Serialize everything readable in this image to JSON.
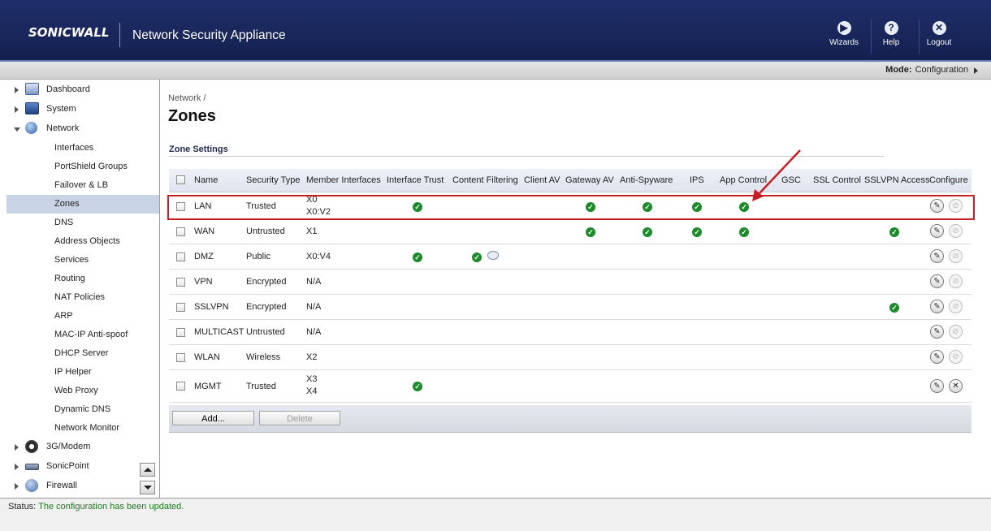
{
  "header": {
    "logo": "SONICWALL",
    "title": "Network Security Appliance",
    "buttons": [
      {
        "label": "Wizards",
        "icon": "wizard-icon",
        "glyph": "▶"
      },
      {
        "label": "Help",
        "icon": "help-icon",
        "glyph": "?"
      },
      {
        "label": "Logout",
        "icon": "logout-icon",
        "glyph": "✕"
      }
    ]
  },
  "mode": {
    "label": "Mode:",
    "value": "Configuration"
  },
  "sidebar": {
    "items": [
      {
        "label": "Dashboard",
        "level": 0,
        "icon": "dashboard-icon",
        "expanded": false
      },
      {
        "label": "System",
        "level": 0,
        "icon": "system-icon",
        "expanded": false
      },
      {
        "label": "Network",
        "level": 0,
        "icon": "network-icon",
        "expanded": true
      },
      {
        "label": "Interfaces",
        "level": 1
      },
      {
        "label": "PortShield Groups",
        "level": 1
      },
      {
        "label": "Failover & LB",
        "level": 1
      },
      {
        "label": "Zones",
        "level": 1,
        "active": true
      },
      {
        "label": "DNS",
        "level": 1
      },
      {
        "label": "Address Objects",
        "level": 1
      },
      {
        "label": "Services",
        "level": 1
      },
      {
        "label": "Routing",
        "level": 1
      },
      {
        "label": "NAT Policies",
        "level": 1
      },
      {
        "label": "ARP",
        "level": 1
      },
      {
        "label": "MAC-IP Anti-spoof",
        "level": 1
      },
      {
        "label": "DHCP Server",
        "level": 1
      },
      {
        "label": "IP Helper",
        "level": 1
      },
      {
        "label": "Web Proxy",
        "level": 1
      },
      {
        "label": "Dynamic DNS",
        "level": 1
      },
      {
        "label": "Network Monitor",
        "level": 1
      },
      {
        "label": "3G/Modem",
        "level": 0,
        "icon": "modem-icon",
        "expanded": false
      },
      {
        "label": "SonicPoint",
        "level": 0,
        "icon": "sonicpoint-icon",
        "expanded": false
      },
      {
        "label": "Firewall",
        "level": 0,
        "icon": "firewall-icon",
        "expanded": false
      }
    ]
  },
  "main": {
    "breadcrumb": "Network /",
    "title": "Zones",
    "section": "Zone Settings",
    "columns": [
      "Name",
      "Security Type",
      "Member Interfaces",
      "Interface Trust",
      "Content Filtering",
      "Client AV",
      "Gateway AV",
      "Anti-Spyware",
      "IPS",
      "App Control",
      "GSC",
      "SSL Control",
      "SSLVPN Access",
      "Configure"
    ],
    "rows": [
      {
        "name": "LAN",
        "type": "Trusted",
        "members": [
          "X0",
          "X0:V2"
        ],
        "checks": [
          "interface_trust",
          "gateway_av",
          "anti_spyware",
          "ips",
          "app_control"
        ],
        "deletable": false,
        "highlighted": true
      },
      {
        "name": "WAN",
        "type": "Untrusted",
        "members": [
          "X1"
        ],
        "checks": [
          "gateway_av",
          "anti_spyware",
          "ips",
          "app_control",
          "sslvpn_access"
        ],
        "deletable": false
      },
      {
        "name": "DMZ",
        "type": "Public",
        "members": [
          "X0:V4"
        ],
        "checks": [
          "interface_trust",
          "content_filtering"
        ],
        "comment": true,
        "deletable": false
      },
      {
        "name": "VPN",
        "type": "Encrypted",
        "members": [
          "N/A"
        ],
        "checks": [],
        "deletable": false
      },
      {
        "name": "SSLVPN",
        "type": "Encrypted",
        "members": [
          "N/A"
        ],
        "checks": [
          "sslvpn_access"
        ],
        "deletable": false
      },
      {
        "name": "MULTICAST",
        "type": "Untrusted",
        "members": [
          "N/A"
        ],
        "checks": [],
        "deletable": false
      },
      {
        "name": "WLAN",
        "type": "Wireless",
        "members": [
          "X2"
        ],
        "checks": [],
        "deletable": false
      },
      {
        "name": "MGMT",
        "type": "Trusted",
        "members": [
          "X3",
          "X4"
        ],
        "checks": [
          "interface_trust"
        ],
        "deletable": true
      }
    ],
    "buttons": {
      "add": "Add...",
      "delete": "Delete"
    }
  },
  "status": {
    "label": "Status:",
    "value": "The configuration has been updated."
  },
  "colors": {
    "header": "#1a2a5e",
    "accent_red": "#c81e24",
    "check_green": "#1a8a2a",
    "active_nav": "#c9d3e6"
  }
}
